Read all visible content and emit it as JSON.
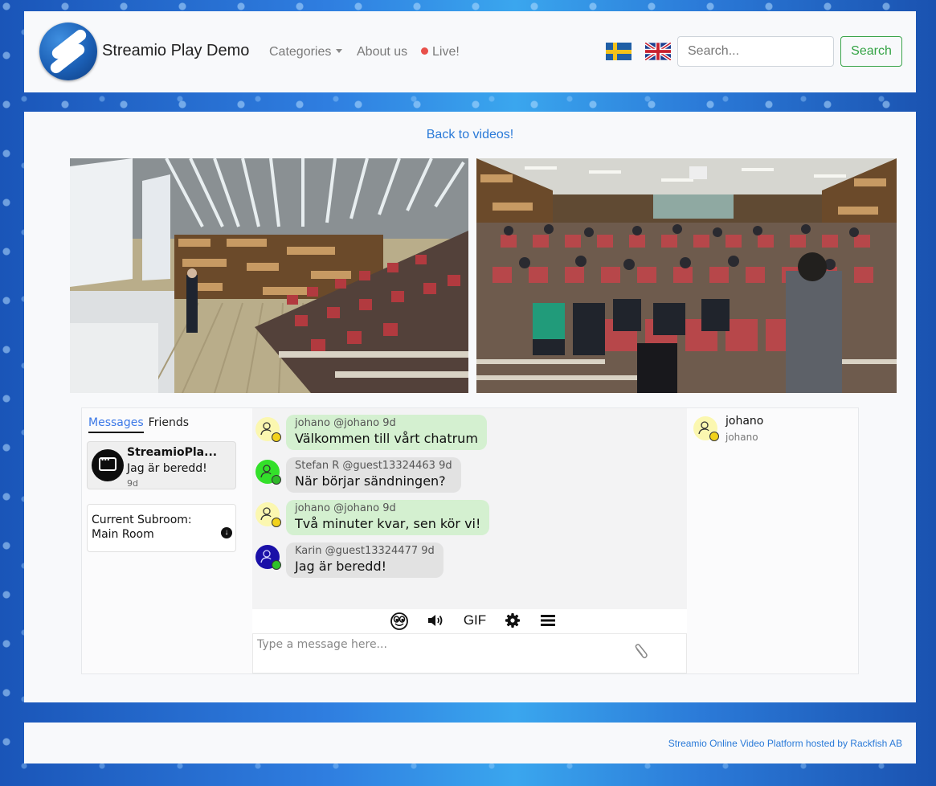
{
  "navbar": {
    "brand": "Streamio Play Demo",
    "links": {
      "categories": "Categories",
      "about": "About us",
      "live": "Live!"
    },
    "languages": [
      {
        "code": "sv",
        "icon": "swedish-flag-icon"
      },
      {
        "code": "en",
        "icon": "uk-flag-icon"
      }
    ],
    "search": {
      "placeholder": "Search...",
      "value": "",
      "button_label": "Search"
    },
    "colors": {
      "live_dot": "#e8504a",
      "search_button": "#33a344"
    }
  },
  "main": {
    "back_link": "Back to videos!",
    "videos": [
      {
        "description": "Lecture hall with speaker in front of projection screens"
      },
      {
        "description": "Audience in red seats facing a speaker"
      }
    ]
  },
  "chat": {
    "tabs": [
      {
        "label": "Messages",
        "active": true
      },
      {
        "label": "Friends",
        "active": false
      }
    ],
    "conversation": {
      "name": "StreamioPla...",
      "last_message": "Jag är beredd!",
      "time": "9d"
    },
    "subroom": {
      "label": "Current Subroom:",
      "value": "Main Room"
    },
    "messages": [
      {
        "name": "johano",
        "handle": "@johano",
        "time": "9d",
        "meta": "johano @johano 9d",
        "text": "Välkommen till vårt chatrum",
        "own": true,
        "avatar_color": "#fbf7b0",
        "status_color": "#f2d21b"
      },
      {
        "name": "Stefan R",
        "handle": "@guest13324463",
        "time": "9d",
        "meta": "Stefan R @guest13324463 9d",
        "text": "När börjar sändningen?",
        "own": false,
        "avatar_color": "#33e02a",
        "status_color": "#2fb82a"
      },
      {
        "name": "johano",
        "handle": "@johano",
        "time": "9d",
        "meta": "johano @johano 9d",
        "text": "Två minuter kvar, sen kör vi!",
        "own": true,
        "avatar_color": "#fbf7b0",
        "status_color": "#f2d21b"
      },
      {
        "name": "Karin",
        "handle": "@guest13324477",
        "time": "9d",
        "meta": "Karin @guest13324477 9d",
        "text": "Jag är beredd!",
        "own": false,
        "avatar_color": "#1a10a8",
        "status_color": "#2fc12a"
      }
    ],
    "toolbar": {
      "emoji": "emoji-icon",
      "sound": "volume-icon",
      "gif_label": "GIF",
      "settings": "gear-icon",
      "menu": "menu-icon"
    },
    "input": {
      "placeholder": "Type a message here...",
      "value": ""
    },
    "users": [
      {
        "name": "johano",
        "handle": "johano",
        "status_color": "#f2d21b"
      }
    ]
  },
  "footer": {
    "text": "Streamio Online Video Platform hosted by Rackfish AB"
  }
}
